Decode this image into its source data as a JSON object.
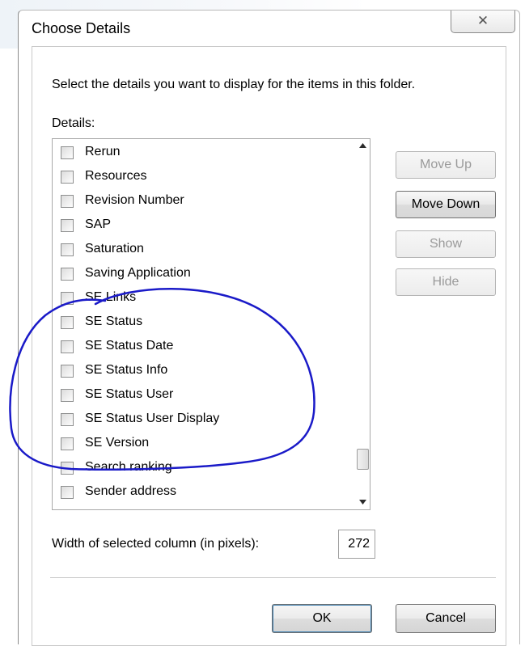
{
  "dialog": {
    "title": "Choose Details",
    "close_glyph": "✕",
    "instructions": "Select the details you want to display for the items in this folder.",
    "details_label": "Details:",
    "items": [
      {
        "label": "Rerun",
        "checked": false
      },
      {
        "label": "Resources",
        "checked": false
      },
      {
        "label": "Revision Number",
        "checked": false
      },
      {
        "label": "SAP",
        "checked": false
      },
      {
        "label": "Saturation",
        "checked": false
      },
      {
        "label": "Saving Application",
        "checked": false
      },
      {
        "label": "SE Links",
        "checked": false
      },
      {
        "label": "SE Status",
        "checked": false
      },
      {
        "label": "SE Status Date",
        "checked": false
      },
      {
        "label": "SE Status Info",
        "checked": false
      },
      {
        "label": "SE Status User",
        "checked": false
      },
      {
        "label": "SE Status User Display",
        "checked": false
      },
      {
        "label": "SE Version",
        "checked": false
      },
      {
        "label": "Search ranking",
        "checked": false
      },
      {
        "label": "Sender address",
        "checked": false
      },
      {
        "label": "",
        "checked": false
      }
    ],
    "scroll_position": 0.92,
    "buttons": {
      "move_up": "Move Up",
      "move_down": "Move Down",
      "show": "Show",
      "hide": "Hide",
      "ok": "OK",
      "cancel": "Cancel"
    },
    "width_label": "Width of selected column (in pixels):",
    "width_value": "272",
    "annotation_color": "#1a1ac8"
  }
}
